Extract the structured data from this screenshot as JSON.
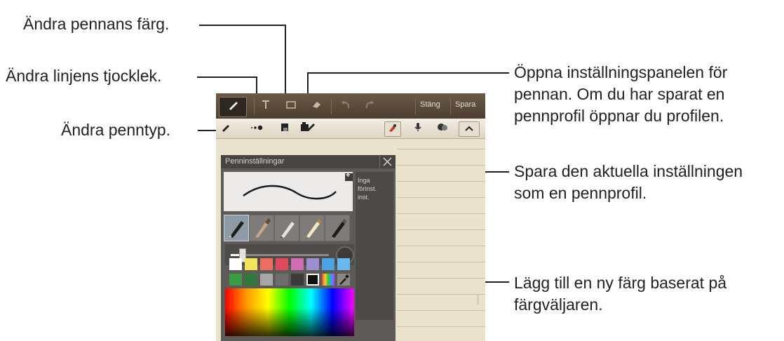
{
  "callouts": {
    "pen_color": "Ändra pennans färg.",
    "line_thickness": "Ändra linjens tjocklek.",
    "pen_type": "Ändra penntyp.",
    "open_settings": [
      "Öppna inställningspanelen för",
      "pennan. Om du har sparat en",
      "pennprofil öppnar du profilen."
    ],
    "save_setting": [
      "Spara den aktuella inställningen",
      "som en pennprofil."
    ],
    "add_color": [
      "Lägg till en ny färg baserat på",
      "färgväljaren."
    ]
  },
  "app": {
    "close_label": "Stäng",
    "save_label": "Spara"
  },
  "panel": {
    "title": "Penninställningar",
    "presets_empty": [
      "Inga",
      "förinst.",
      "inst."
    ],
    "colors_row1": [
      "#ffffff",
      "#f3e35a",
      "#ee6d61",
      "#e2485b",
      "#d06bb5",
      "#9b8ed3",
      "#4aa3e2",
      "#6ab9ee"
    ],
    "colors_row2": [
      "#3a9a46",
      "#2f7a3a",
      "#a7a7a7",
      "#6d6d6d",
      "#3a3a3a",
      "#111111"
    ]
  },
  "icons": [
    "pen-mode-icon",
    "text-mode-icon",
    "image-icon",
    "eraser-icon",
    "undo-icon",
    "redo-icon",
    "pen-type-icon",
    "line-thickness-icon",
    "pen-color-icon",
    "pen-settings-icon",
    "brush-icon",
    "microphone-icon",
    "palette-icon",
    "collapse-icon",
    "add-preset-icon",
    "close-icon",
    "eyedropper-icon",
    "expand-icon"
  ]
}
